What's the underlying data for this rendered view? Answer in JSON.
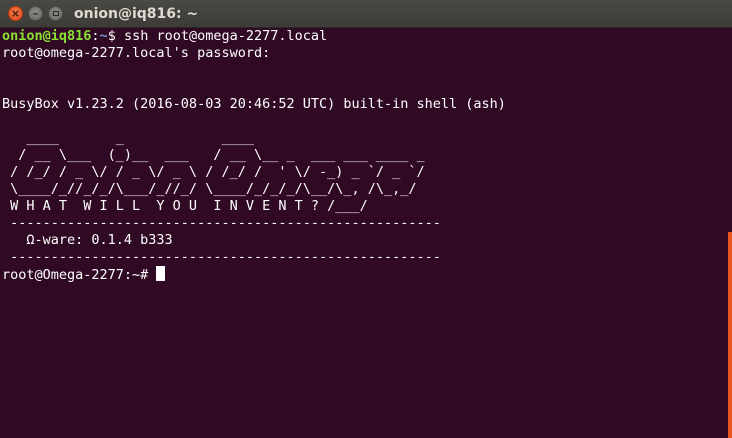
{
  "window": {
    "title": "onion@iq816: ~",
    "close_glyph": "×",
    "minimize_glyph": "–",
    "maximize_glyph": ""
  },
  "terminal": {
    "colors": {
      "background": "#300a24",
      "prompt_user": "#8ae234",
      "prompt_path": "#729fcf",
      "text": "#ffffff",
      "scrollbar": "#e95420"
    },
    "prompt_user": "onion@iq816",
    "prompt_sep": ":",
    "prompt_path": "~",
    "prompt_symbol": "$ ",
    "command": "ssh root@omega-2277.local",
    "lines": [
      "root@omega-2277.local's password: ",
      "",
      "",
      "BusyBox v1.23.2 (2016-08-03 20:46:52 UTC) built-in shell (ash)",
      "",
      "   ____       _            ____",
      "  / __ \\___  (_)__  ___   / __ \\__ _  ___ ___ ____ _",
      " / /_/ / _ \\/ / _ \\/ _ \\ / /_/ /  ' \\/ -_) _ `/ _ `/",
      " \\____/_//_/_/\\___/_//_/ \\____/_/_/_/\\__/\\_, /\\_,_/",
      " W H A T  W I L L  Y O U  I N V E N T ? /___/",
      " -----------------------------------------------------",
      "   Ω-ware: 0.1.4 b333",
      " -----------------------------------------------------"
    ],
    "final_prompt": "root@Omega-2277:~# "
  }
}
